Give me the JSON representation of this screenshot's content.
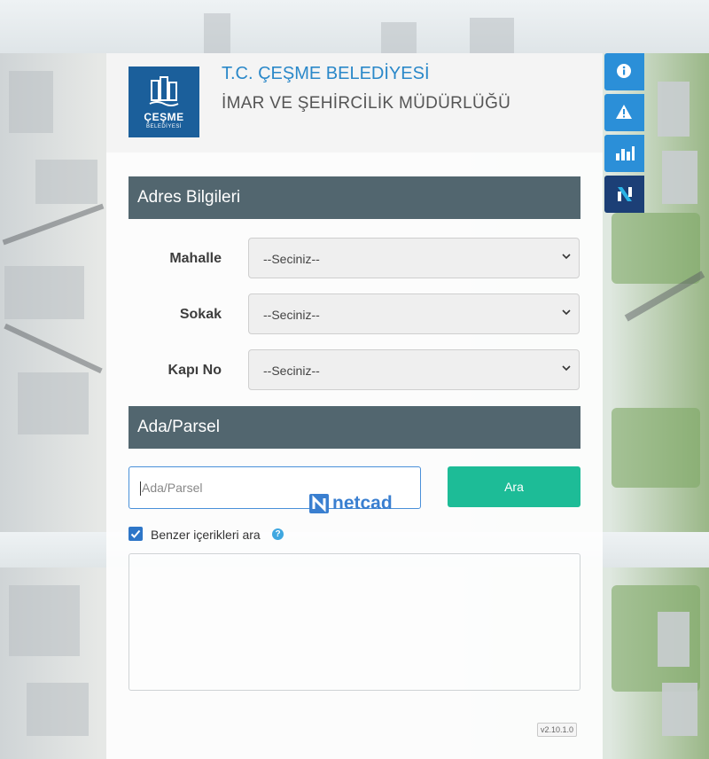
{
  "header": {
    "logo_line1": "ÇEŞME",
    "logo_line2": "BELEDİYESİ",
    "title": "T.C. ÇEŞME BELEDİYESİ",
    "subtitle": "İMAR VE ŞEHİRCİLİK MÜDÜRLÜĞÜ"
  },
  "address": {
    "heading": "Adres Bilgileri",
    "fields": [
      {
        "label": "Mahalle",
        "value": "--Seciniz--"
      },
      {
        "label": "Sokak",
        "value": "--Seciniz--"
      },
      {
        "label": "Kapı No",
        "value": "--Seciniz--"
      }
    ]
  },
  "parcel": {
    "heading": "Ada/Parsel",
    "placeholder": "Ada/Parsel",
    "search_label": "Ara"
  },
  "watermark": "netcad",
  "similar": {
    "label": "Benzer içerikleri ara",
    "checked": true,
    "help": "?"
  },
  "version": "v2.10.1.0",
  "side_buttons": [
    "info-icon",
    "warning-icon",
    "chart-icon",
    "netcad-logo-icon"
  ],
  "colors": {
    "brand_blue": "#2a88c9",
    "section_bg": "#52666f",
    "search_button": "#1dbc97",
    "side_button": "#2b8fd8"
  }
}
